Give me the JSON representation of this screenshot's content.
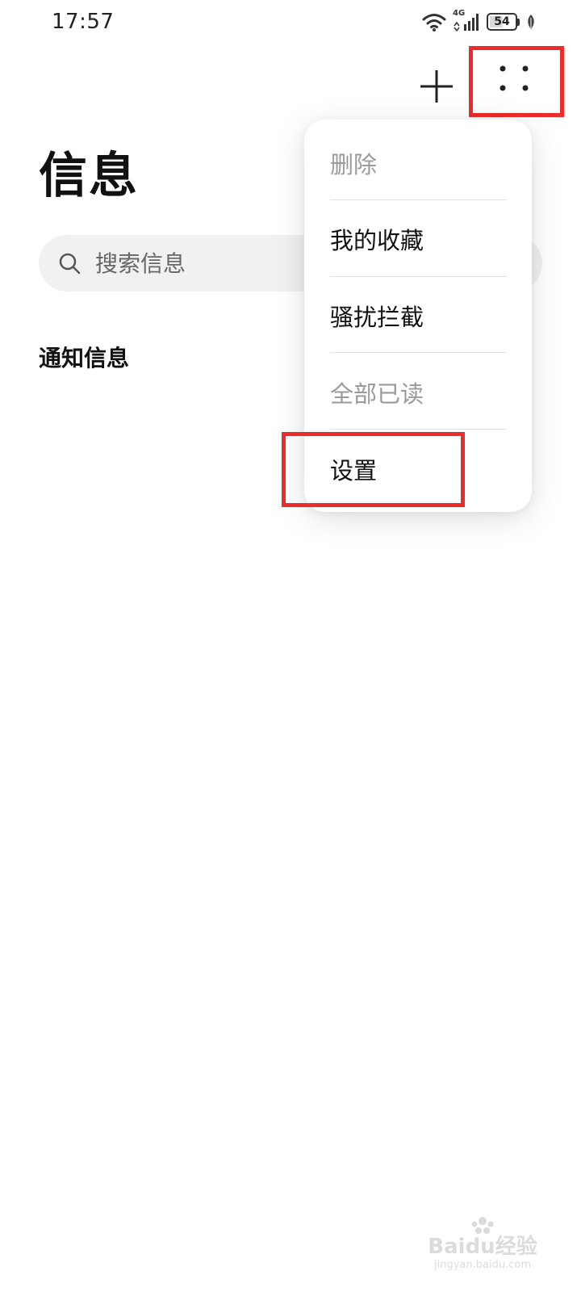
{
  "status_bar": {
    "time": "17:57",
    "network": "4G",
    "battery": "54",
    "battery_level": 0.54,
    "icons": [
      "wifi-icon",
      "cellular-signal-icon",
      "battery-icon",
      "leaf-icon"
    ]
  },
  "action_bar": {
    "add_icon": "plus-icon",
    "more_icon": "more-dots-icon"
  },
  "page": {
    "title": "信息",
    "search_placeholder": "搜索信息",
    "section_title": "通知信息"
  },
  "menu": {
    "items": [
      {
        "label": "删除",
        "enabled": false
      },
      {
        "label": "我的收藏",
        "enabled": true
      },
      {
        "label": "骚扰拦截",
        "enabled": true
      },
      {
        "label": "全部已读",
        "enabled": false
      },
      {
        "label": "设置",
        "enabled": true
      }
    ]
  },
  "watermark": {
    "logo_text": "Baidu经验",
    "url_text": "jingyan.baidu.com"
  },
  "colors": {
    "highlight": "#ee2b2b",
    "disabled_text": "#9a9a9a",
    "search_bg": "#f1f1f1"
  }
}
